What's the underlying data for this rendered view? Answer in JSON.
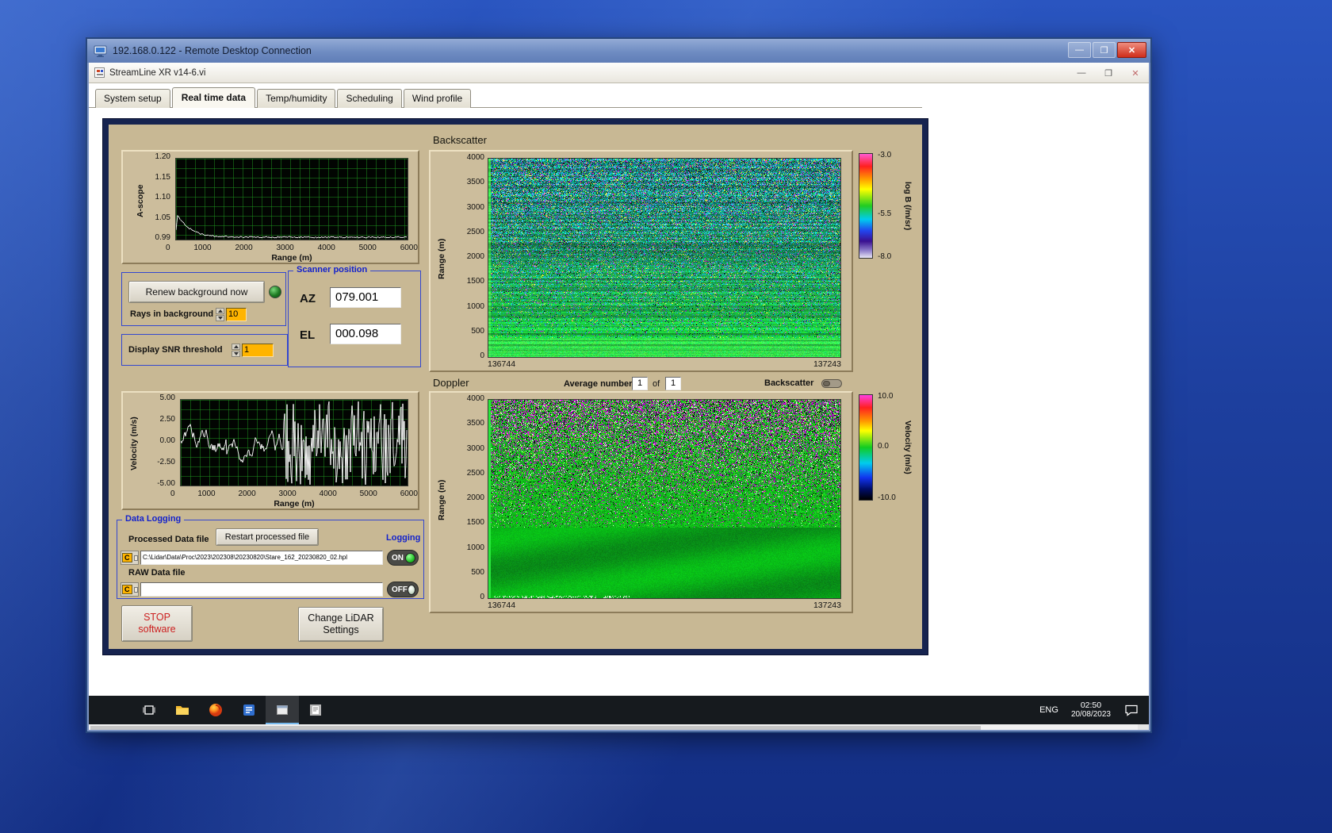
{
  "icons": {
    "minimize": "—",
    "restore": "❐",
    "close": "✕"
  },
  "colors": {
    "panel_tan": "#c8b894",
    "group_border_blue": "#3347cf",
    "led_green": "#25c42a",
    "stop_text_red": "#cc1f1f",
    "spinner_orange": "#ffb400",
    "desktop_blue": "#1d3f9e"
  },
  "rdp": {
    "title": "192.168.0.122 - Remote Desktop Connection"
  },
  "app": {
    "title": "StreamLine XR v14-6.vi",
    "tabs": [
      "System setup",
      "Real time data",
      "Temp/humidity",
      "Scheduling",
      "Wind profile"
    ],
    "active_tab_index": 1
  },
  "ascope": {
    "ylabel": "A-scope",
    "yticks": [
      "1.20",
      "1.15",
      "1.10",
      "1.05",
      "0.99"
    ],
    "xticks": [
      "0",
      "1000",
      "2000",
      "3000",
      "4000",
      "5000",
      "6000"
    ],
    "xlabel": "Range (m)"
  },
  "background_controls": {
    "renew_button": "Renew background now",
    "rays_label": "Rays in background",
    "rays_value": "10",
    "snr_label": "Display SNR threshold",
    "snr_value": "1"
  },
  "scanner": {
    "group_label": "Scanner position",
    "az_label": "AZ",
    "az_value": "079.001",
    "el_label": "EL",
    "el_value": "000.098"
  },
  "backscatter": {
    "title": "Backscatter",
    "ylabel": "Range (m)",
    "yticks": [
      "4000",
      "3500",
      "3000",
      "2500",
      "2000",
      "1500",
      "1000",
      "500",
      "0"
    ],
    "x_start": "136744",
    "x_end": "137243",
    "colorbar": {
      "label": "log B (/m/sr)",
      "ticks": [
        "-3.0",
        "-5.5",
        "-8.0"
      ]
    }
  },
  "doppler_header": {
    "title": "Doppler",
    "average_label": "Average number",
    "average_value": "1",
    "of_label": "of",
    "of_value": "1",
    "backscatter_toggle_label": "Backscatter"
  },
  "doppler": {
    "ylabel": "Range (m)",
    "yticks": [
      "4000",
      "3500",
      "3000",
      "2500",
      "2000",
      "1500",
      "1000",
      "500",
      "0"
    ],
    "x_start": "136744",
    "x_end": "137243",
    "colorbar": {
      "label": "Velocity (m/s)",
      "ticks": [
        "10.0",
        "0.0",
        "-10.0"
      ]
    }
  },
  "velocity": {
    "ylabel": "Velocity (m/s)",
    "yticks": [
      "5.00",
      "2.50",
      "0.00",
      "-2.50",
      "-5.00"
    ],
    "xticks": [
      "0",
      "1000",
      "2000",
      "3000",
      "4000",
      "5000",
      "6000"
    ],
    "xlabel": "Range (m)"
  },
  "logging": {
    "group_label": "Data Logging",
    "processed_label": "Processed Data file",
    "restart_button": "Restart processed file",
    "logging_label": "Logging",
    "drive_label": "C",
    "processed_path": "C:\\Lidar\\Data\\Proc\\2023\\202308\\20230820\\Stare_162_20230820_02.hpl",
    "on_label": "ON",
    "raw_label": "RAW Data file",
    "raw_path": "",
    "off_label": "OFF"
  },
  "footer_buttons": {
    "stop_line1": "STOP",
    "stop_line2": "software",
    "change_line1": "Change LiDAR",
    "change_line2": "Settings"
  },
  "taskbar": {
    "lang": "ENG",
    "time": "02:50",
    "date": "20/08/2023"
  }
}
